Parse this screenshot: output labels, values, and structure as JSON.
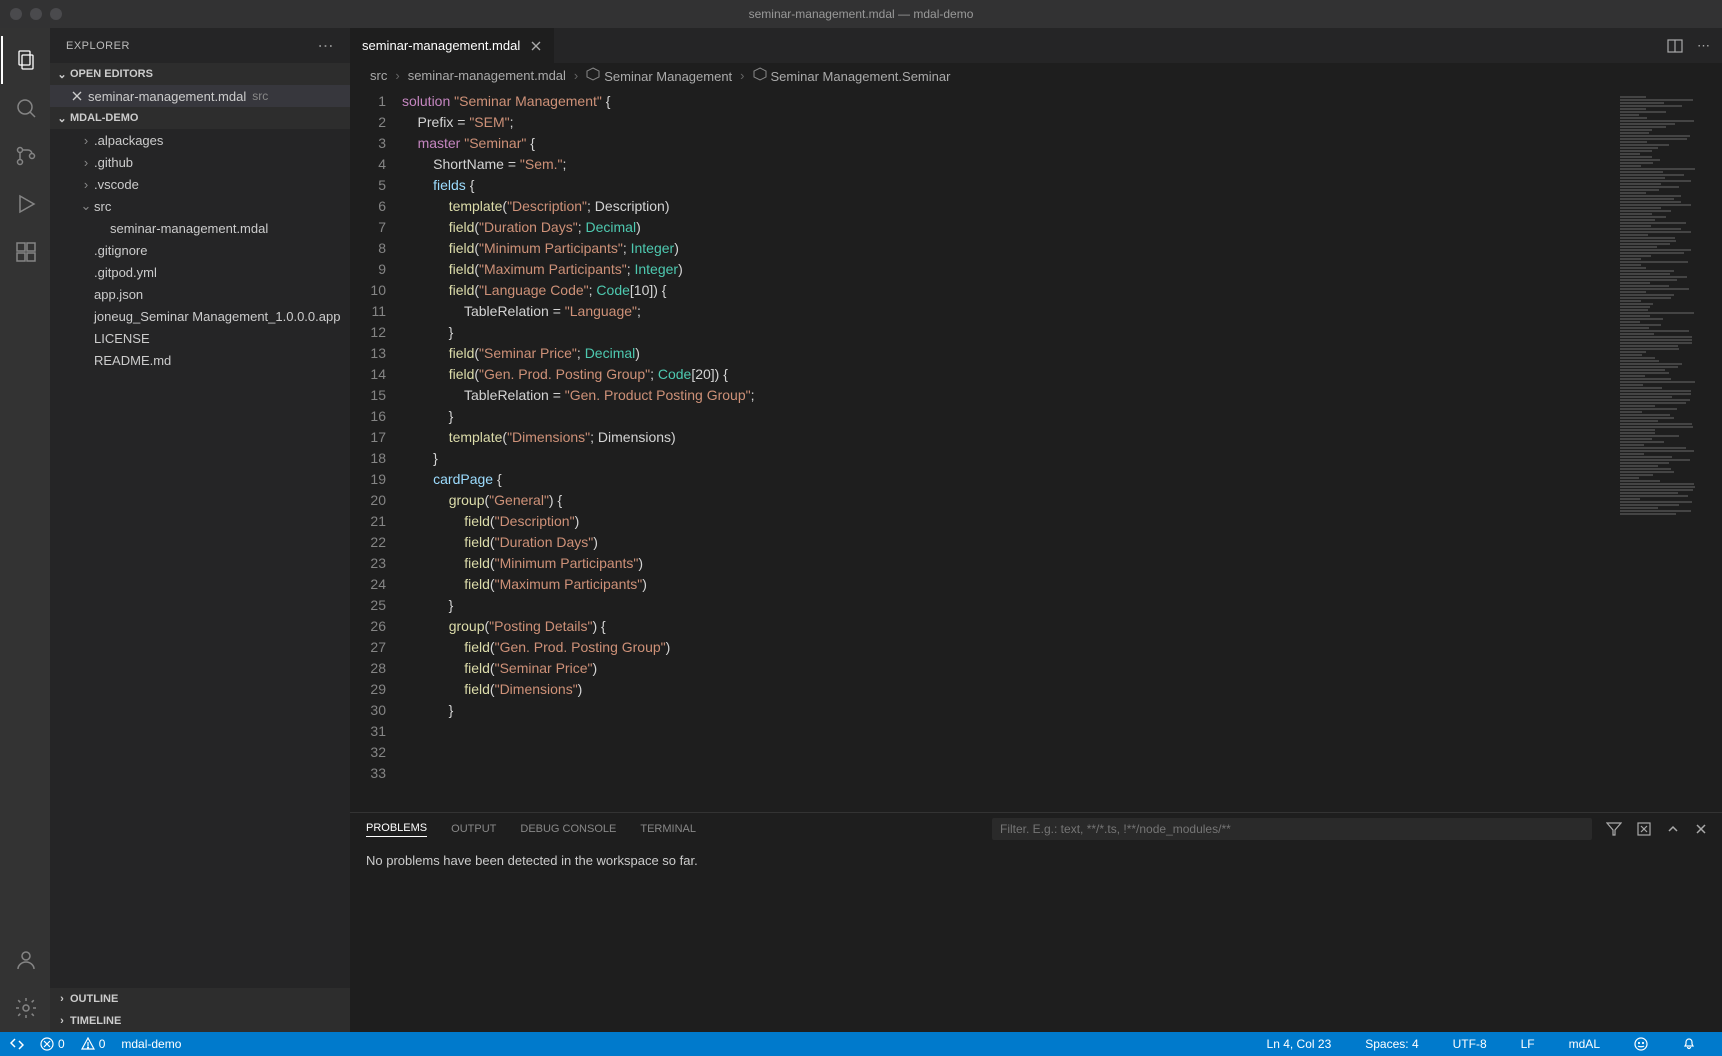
{
  "window": {
    "title": "seminar-management.mdal — mdal-demo"
  },
  "sidebar": {
    "title": "EXPLORER",
    "sections": {
      "openEditors": {
        "label": "OPEN EDITORS",
        "item": {
          "name": "seminar-management.mdal",
          "dir": "src"
        }
      },
      "project": {
        "label": "MDAL-DEMO",
        "tree": [
          {
            "name": ".alpackages",
            "kind": "folder"
          },
          {
            "name": ".github",
            "kind": "folder"
          },
          {
            "name": ".vscode",
            "kind": "folder"
          },
          {
            "name": "src",
            "kind": "folder-open"
          },
          {
            "name": "seminar-management.mdal",
            "kind": "file",
            "indent": 2
          },
          {
            "name": ".gitignore",
            "kind": "file"
          },
          {
            "name": ".gitpod.yml",
            "kind": "file"
          },
          {
            "name": "app.json",
            "kind": "file"
          },
          {
            "name": "joneug_Seminar Management_1.0.0.0.app",
            "kind": "file"
          },
          {
            "name": "LICENSE",
            "kind": "file"
          },
          {
            "name": "README.md",
            "kind": "file"
          }
        ]
      },
      "outline": {
        "label": "OUTLINE"
      },
      "timeline": {
        "label": "TIMELINE"
      }
    }
  },
  "tabs": {
    "active": "seminar-management.mdal"
  },
  "breadcrumbs": [
    {
      "label": "src"
    },
    {
      "label": "seminar-management.mdal"
    },
    {
      "label": "Seminar Management",
      "icon": true
    },
    {
      "label": "Seminar Management.Seminar",
      "icon": true
    }
  ],
  "code": {
    "lines": [
      [
        {
          "t": "solution",
          "c": "kw"
        },
        {
          "t": " "
        },
        {
          "t": "\"Seminar Management\"",
          "c": "str"
        },
        {
          "t": " {"
        }
      ],
      [
        {
          "t": "    Prefix = "
        },
        {
          "t": "\"SEM\"",
          "c": "str"
        },
        {
          "t": ";"
        }
      ],
      [
        {
          "t": ""
        }
      ],
      [
        {
          "t": "    "
        },
        {
          "t": "master",
          "c": "kw"
        },
        {
          "t": " "
        },
        {
          "t": "\"Seminar\"",
          "c": "str"
        },
        {
          "t": " {"
        }
      ],
      [
        {
          "t": "        ShortName = "
        },
        {
          "t": "\"Sem.\"",
          "c": "str"
        },
        {
          "t": ";"
        }
      ],
      [
        {
          "t": ""
        }
      ],
      [
        {
          "t": "        "
        },
        {
          "t": "fields",
          "c": "prop"
        },
        {
          "t": " {"
        }
      ],
      [
        {
          "t": "            "
        },
        {
          "t": "template",
          "c": "fn"
        },
        {
          "t": "("
        },
        {
          "t": "\"Description\"",
          "c": "str"
        },
        {
          "t": "; Description)"
        }
      ],
      [
        {
          "t": "            "
        },
        {
          "t": "field",
          "c": "fn"
        },
        {
          "t": "("
        },
        {
          "t": "\"Duration Days\"",
          "c": "str"
        },
        {
          "t": "; "
        },
        {
          "t": "Decimal",
          "c": "type"
        },
        {
          "t": ")"
        }
      ],
      [
        {
          "t": "            "
        },
        {
          "t": "field",
          "c": "fn"
        },
        {
          "t": "("
        },
        {
          "t": "\"Minimum Participants\"",
          "c": "str"
        },
        {
          "t": "; "
        },
        {
          "t": "Integer",
          "c": "type"
        },
        {
          "t": ")"
        }
      ],
      [
        {
          "t": "            "
        },
        {
          "t": "field",
          "c": "fn"
        },
        {
          "t": "("
        },
        {
          "t": "\"Maximum Participants\"",
          "c": "str"
        },
        {
          "t": "; "
        },
        {
          "t": "Integer",
          "c": "type"
        },
        {
          "t": ")"
        }
      ],
      [
        {
          "t": "            "
        },
        {
          "t": "field",
          "c": "fn"
        },
        {
          "t": "("
        },
        {
          "t": "\"Language Code\"",
          "c": "str"
        },
        {
          "t": "; "
        },
        {
          "t": "Code",
          "c": "type"
        },
        {
          "t": "[10]) {"
        }
      ],
      [
        {
          "t": "                TableRelation = "
        },
        {
          "t": "\"Language\"",
          "c": "str"
        },
        {
          "t": ";"
        }
      ],
      [
        {
          "t": "            }"
        }
      ],
      [
        {
          "t": "            "
        },
        {
          "t": "field",
          "c": "fn"
        },
        {
          "t": "("
        },
        {
          "t": "\"Seminar Price\"",
          "c": "str"
        },
        {
          "t": "; "
        },
        {
          "t": "Decimal",
          "c": "type"
        },
        {
          "t": ")"
        }
      ],
      [
        {
          "t": "            "
        },
        {
          "t": "field",
          "c": "fn"
        },
        {
          "t": "("
        },
        {
          "t": "\"Gen. Prod. Posting Group\"",
          "c": "str"
        },
        {
          "t": "; "
        },
        {
          "t": "Code",
          "c": "type"
        },
        {
          "t": "[20]) {"
        }
      ],
      [
        {
          "t": "                TableRelation = "
        },
        {
          "t": "\"Gen. Product Posting Group\"",
          "c": "str"
        },
        {
          "t": ";"
        }
      ],
      [
        {
          "t": "            }"
        }
      ],
      [
        {
          "t": "            "
        },
        {
          "t": "template",
          "c": "fn"
        },
        {
          "t": "("
        },
        {
          "t": "\"Dimensions\"",
          "c": "str"
        },
        {
          "t": "; Dimensions)"
        }
      ],
      [
        {
          "t": "        }"
        }
      ],
      [
        {
          "t": ""
        }
      ],
      [
        {
          "t": "        "
        },
        {
          "t": "cardPage",
          "c": "prop"
        },
        {
          "t": " {"
        }
      ],
      [
        {
          "t": "            "
        },
        {
          "t": "group",
          "c": "fn"
        },
        {
          "t": "("
        },
        {
          "t": "\"General\"",
          "c": "str"
        },
        {
          "t": ") {"
        }
      ],
      [
        {
          "t": "                "
        },
        {
          "t": "field",
          "c": "fn"
        },
        {
          "t": "("
        },
        {
          "t": "\"Description\"",
          "c": "str"
        },
        {
          "t": ")"
        }
      ],
      [
        {
          "t": "                "
        },
        {
          "t": "field",
          "c": "fn"
        },
        {
          "t": "("
        },
        {
          "t": "\"Duration Days\"",
          "c": "str"
        },
        {
          "t": ")"
        }
      ],
      [
        {
          "t": "                "
        },
        {
          "t": "field",
          "c": "fn"
        },
        {
          "t": "("
        },
        {
          "t": "\"Minimum Participants\"",
          "c": "str"
        },
        {
          "t": ")"
        }
      ],
      [
        {
          "t": "                "
        },
        {
          "t": "field",
          "c": "fn"
        },
        {
          "t": "("
        },
        {
          "t": "\"Maximum Participants\"",
          "c": "str"
        },
        {
          "t": ")"
        }
      ],
      [
        {
          "t": "            }"
        }
      ],
      [
        {
          "t": "            "
        },
        {
          "t": "group",
          "c": "fn"
        },
        {
          "t": "("
        },
        {
          "t": "\"Posting Details\"",
          "c": "str"
        },
        {
          "t": ") {"
        }
      ],
      [
        {
          "t": "                "
        },
        {
          "t": "field",
          "c": "fn"
        },
        {
          "t": "("
        },
        {
          "t": "\"Gen. Prod. Posting Group\"",
          "c": "str"
        },
        {
          "t": ")"
        }
      ],
      [
        {
          "t": "                "
        },
        {
          "t": "field",
          "c": "fn"
        },
        {
          "t": "("
        },
        {
          "t": "\"Seminar Price\"",
          "c": "str"
        },
        {
          "t": ")"
        }
      ],
      [
        {
          "t": "                "
        },
        {
          "t": "field",
          "c": "fn"
        },
        {
          "t": "("
        },
        {
          "t": "\"Dimensions\"",
          "c": "str"
        },
        {
          "t": ")"
        }
      ],
      [
        {
          "t": "            }"
        }
      ]
    ]
  },
  "panel": {
    "tabs": {
      "problems": "PROBLEMS",
      "output": "OUTPUT",
      "debug": "DEBUG CONSOLE",
      "terminal": "TERMINAL"
    },
    "filterPlaceholder": "Filter. E.g.: text, **/*.ts, !**/node_modules/**",
    "body": "No problems have been detected in the workspace so far."
  },
  "status": {
    "remote": "",
    "errors": "0",
    "warnings": "0",
    "branch": "mdal-demo",
    "cursor": "Ln 4, Col 23",
    "spaces": "Spaces: 4",
    "encoding": "UTF-8",
    "eol": "LF",
    "lang": "mdAL"
  }
}
